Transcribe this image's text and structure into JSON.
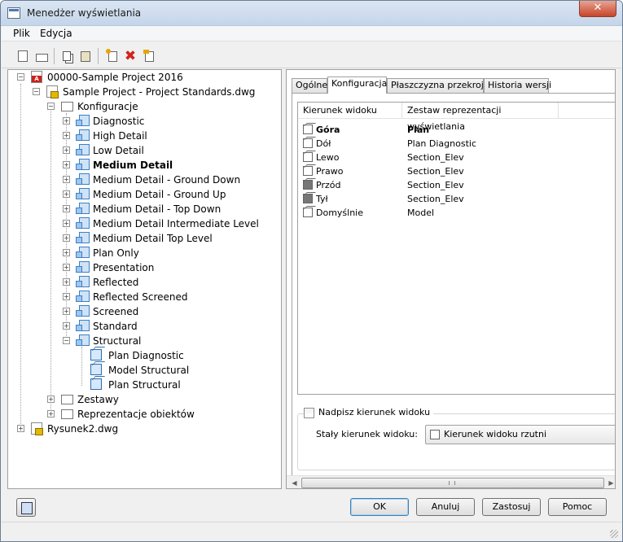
{
  "window": {
    "title": "Menedżer wyświetlania",
    "close_glyph": "✕"
  },
  "menu": {
    "items": [
      {
        "label": "Plik"
      },
      {
        "label": "Edycja"
      }
    ]
  },
  "toolbar": {
    "buttons": [
      {
        "icon": "new-icon"
      },
      {
        "icon": "open-icon"
      },
      {
        "icon": "copy-icon"
      },
      {
        "icon": "paste-icon"
      },
      {
        "icon": "new-configuration-icon"
      },
      {
        "icon": "delete-icon",
        "glyph": "✖",
        "color": "#d2231a"
      },
      {
        "icon": "purge-icon"
      }
    ]
  },
  "tree": {
    "project": "00000-Sample Project 2016",
    "standards": "Sample Project - Project Standards.dwg",
    "configs_folder": "Konfiguracje",
    "configs": [
      "Diagnostic",
      "High Detail",
      "Low Detail",
      "Medium Detail",
      "Medium Detail - Ground Down",
      "Medium Detail - Ground Up",
      "Medium Detail - Top Down",
      "Medium Detail Intermediate Level",
      "Medium Detail Top Level",
      "Plan Only",
      "Presentation",
      "Reflected",
      "Reflected Screened",
      "Screened",
      "Standard",
      "Structural"
    ],
    "structural_children": [
      "Plan Diagnostic",
      "Model Structural",
      "Plan Structural"
    ],
    "sets_folder": "Zestawy",
    "objreps_folder": "Reprezentacje obiektów",
    "drawing": "Rysunek2.dwg",
    "bold_item": "Medium Detail"
  },
  "tabs": [
    {
      "label": "Ogólne"
    },
    {
      "label": "Konfiguracja"
    },
    {
      "label": "Płaszczyzna przekroju"
    },
    {
      "label": "Historia wersji"
    }
  ],
  "list": {
    "headers": [
      "Kierunek widoku",
      "Zestaw reprezentacji wyświetlania"
    ],
    "rows": [
      [
        "Góra",
        "Plan"
      ],
      [
        "Dół",
        "Plan Diagnostic"
      ],
      [
        "Lewo",
        "Section_Elev"
      ],
      [
        "Prawo",
        "Section_Elev"
      ],
      [
        "Przód",
        "Section_Elev"
      ],
      [
        "Tył",
        "Section_Elev"
      ],
      [
        "Domyślnie",
        "Model"
      ]
    ]
  },
  "options": {
    "override_checkbox": "Nadpisz kierunek widoku",
    "fixed_label": "Stały kierunek widoku:",
    "fixed_value": "Kierunek widoku rzutni"
  },
  "buttons": {
    "ok": "OK",
    "cancel": "Anuluj",
    "apply": "Zastosuj",
    "help": "Pomoc"
  }
}
